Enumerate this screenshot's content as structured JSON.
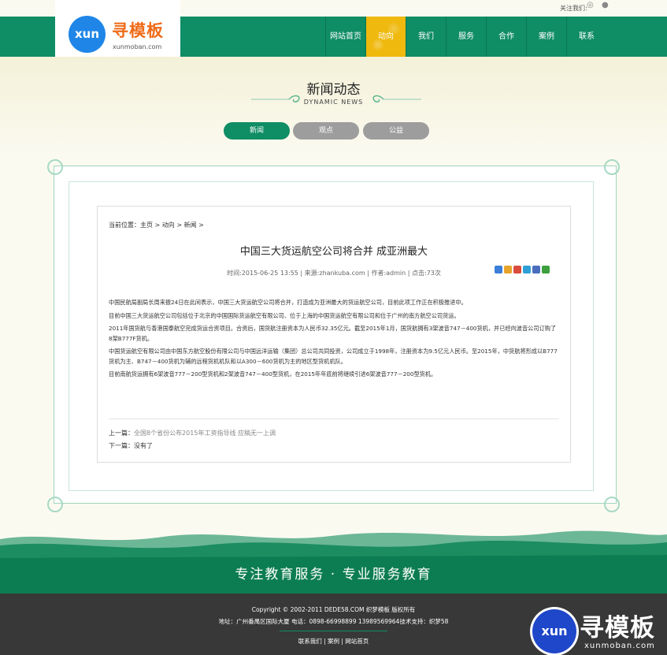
{
  "header": {
    "follow_text": "关注我们:",
    "logo_badge": "xun",
    "logo_name": "寻模板",
    "logo_domain": "xunmoban.com",
    "nav": [
      "网站首页",
      "动向",
      "我们",
      "服务",
      "合作",
      "案例",
      "联系"
    ],
    "active_nav_index": 1
  },
  "section": {
    "title": "新闻动态",
    "subtitle": "DYNAMIC NEWS",
    "tabs": [
      "新闻",
      "观点",
      "公益"
    ],
    "active_tab_index": 0
  },
  "article": {
    "breadcrumb": "当前位置：主页 > 动向 > 新闻 >",
    "title": "中国三大货运航空公司将合并 成亚洲最大",
    "meta": "时间:2015-06-25 13:55 | 来源:zhankuba.com | 作者:admin | 点击:73次",
    "paragraphs": [
      "中国民航局副局长周来振24日在此间表示，中国三大货运航空公司将合并，打造成为亚洲最大的货运航空公司，目前此项工作正在积极推进中。",
      "目前中国三大货运航空公司包括位于北京的中国国际货运航空有限公司、位于上海的中国货运航空有限公司和位于广州的南方航空公司货运。",
      "2011年国货航与香港国泰航空完成货运合资项目。合资后，国货航注册资本为人民币32.35亿元。截至2015年1月，国货航拥有3架波音747－400货机，并已经向波音公司订购了8架B777F货机。",
      "中国货运航空有限公司由中国东方航空股份有限公司与中国远洋运输（集团）总公司共同投资，公司成立于1998年，注册资本为9.5亿元人民币。至2015年，中货航将形成以B777货机为主、B747－400货机为辅的远程货机机队和以A300－600货机为主的地区型货机机队。",
      "目前南航货运拥有6架波音777－200型货机和2架波音747－400型货机，在2015年年底前将继续引进6架波音777－200型货机。"
    ],
    "prev_label": "上一篇：",
    "prev_link": "全国8个省份公布2015年工资指导线 应稿无一上调",
    "next_label": "下一篇：",
    "next_text": "没有了"
  },
  "slogan": "专注教育服务 · 专业服务教育",
  "footer": {
    "copyright": "Copyright © 2002-2011 DEDE58.COM 织梦模板 版权所有",
    "address": "地址：广州番禺区国际大厦 电话：0898-66998899 13989569964技术支持：织梦58",
    "links": "联系我们 | 案例 | 网站首页"
  },
  "watermark": {
    "badge": "xun",
    "name": "寻模板",
    "domain": "xunmoban.com"
  },
  "colors": {
    "primary_green": "#0f8d64",
    "active_yellow": "#efb90e",
    "footer_dark": "#383838"
  }
}
